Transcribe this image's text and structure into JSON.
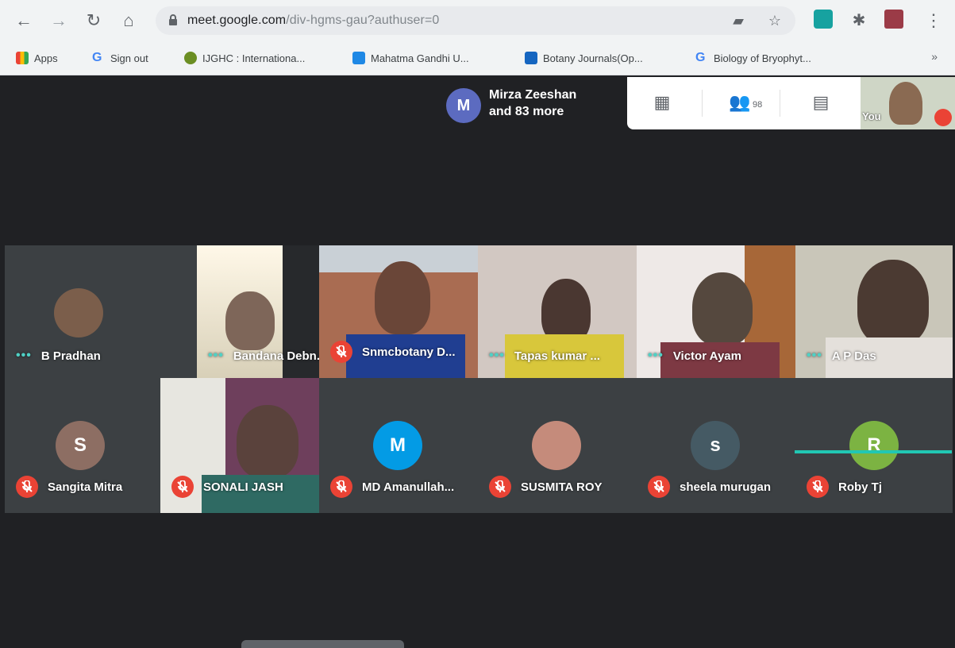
{
  "browser": {
    "url_host": "meet.google.com",
    "url_path": "/div-hgms-gau?authuser=0",
    "bookmarks": [
      {
        "label": "Apps",
        "icon": "apps-grid-icon"
      },
      {
        "label": "Sign out",
        "icon": "google-g-icon"
      },
      {
        "label": "IJGHC : Internationa...",
        "icon": "journal-globe-icon"
      },
      {
        "label": "Mahatma Gandhi U...",
        "icon": "blue-bookmark-icon"
      },
      {
        "label": "Botany Journals(Op...",
        "icon": "leaf-icon"
      },
      {
        "label": "Biology of Bryophyt...",
        "icon": "google-g-icon"
      }
    ],
    "more_bookmarks": "»"
  },
  "meet": {
    "presenter": {
      "initial": "M",
      "name_line1": "Mirza Zeeshan",
      "name_line2": "and 83 more"
    },
    "people_count": "98",
    "you_label": "You",
    "participants": [
      {
        "name": "B Pradhan",
        "status": "speaking-dots",
        "kind": "photo-avatar"
      },
      {
        "name": "Bandana Debn...",
        "status": "speaking-dots",
        "kind": "video"
      },
      {
        "name": "Snmcbotany D...",
        "status": "muted",
        "kind": "video"
      },
      {
        "name": "Tapas kumar ...",
        "status": "speaking-dots",
        "kind": "video"
      },
      {
        "name": "Victor Ayam",
        "status": "speaking-dots",
        "kind": "video"
      },
      {
        "name": "A P Das",
        "status": "speaking-dots",
        "kind": "video"
      },
      {
        "name": "Sangita Mitra",
        "status": "muted",
        "kind": "initial",
        "initial": "S",
        "color": "#8d6e63"
      },
      {
        "name": "SONALI JASH",
        "status": "muted",
        "kind": "video"
      },
      {
        "name": "MD Amanullah...",
        "status": "muted",
        "kind": "initial",
        "initial": "M",
        "color": "#039be5"
      },
      {
        "name": "SUSMITA ROY",
        "status": "muted",
        "kind": "photo-avatar"
      },
      {
        "name": "sheela murugan",
        "status": "muted",
        "kind": "initial",
        "initial": "s",
        "color": "#455a64"
      },
      {
        "name": "Roby Tj",
        "status": "muted",
        "kind": "initial",
        "initial": "R",
        "color": "#7cb342"
      }
    ]
  }
}
